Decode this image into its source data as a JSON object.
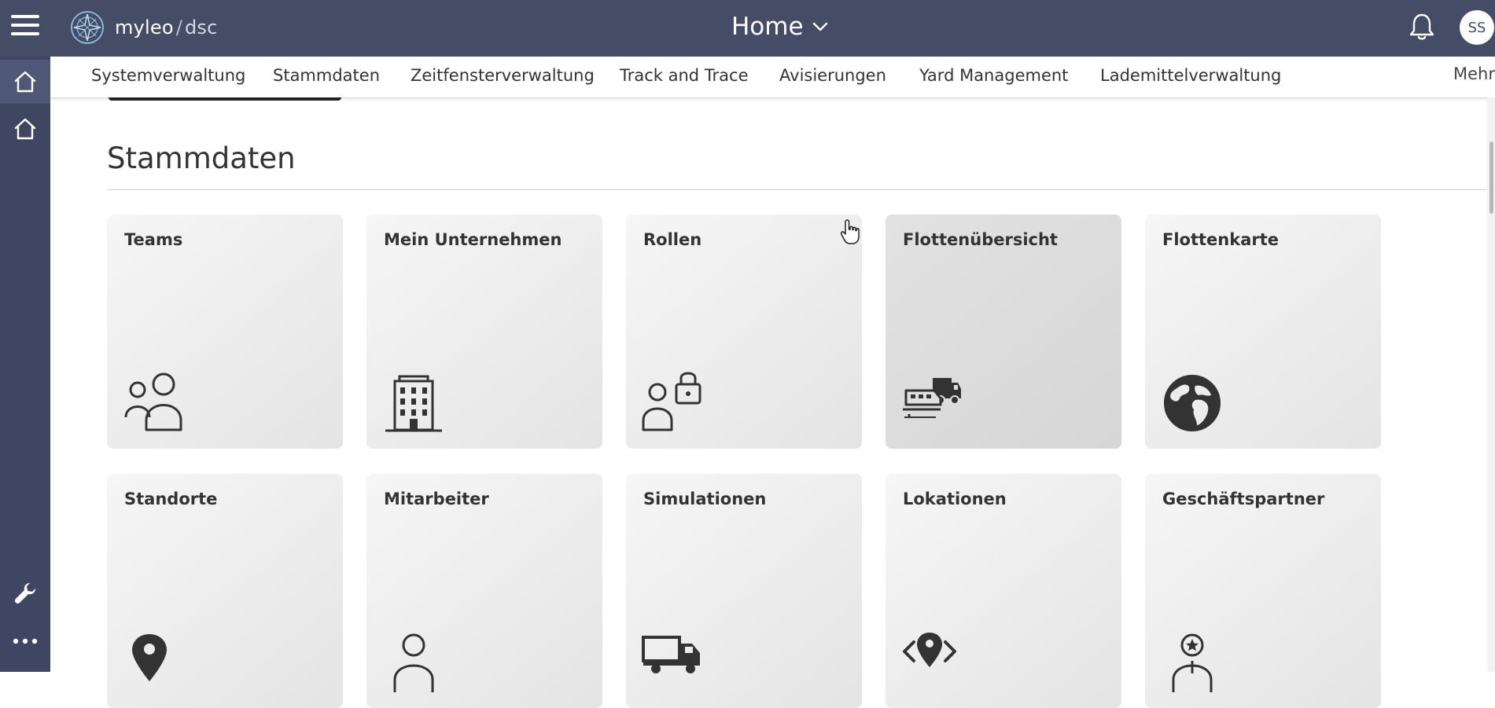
{
  "header": {
    "brand": "myleo",
    "brand_separator": "/",
    "brand_sub": "dsc",
    "title": "Home",
    "avatar_initials": "SS"
  },
  "nav": {
    "tabs": [
      {
        "label": "Systemverwaltung"
      },
      {
        "label": "Stammdaten"
      },
      {
        "label": "Zeitfensterverwaltung"
      },
      {
        "label": "Track and Trace"
      },
      {
        "label": "Avisierungen"
      },
      {
        "label": "Yard Management"
      },
      {
        "label": "Lademittelverwaltung"
      }
    ],
    "more_label": "Mehr"
  },
  "section": {
    "title": "Stammdaten",
    "tiles": [
      {
        "label": "Teams",
        "icon": "teams-icon"
      },
      {
        "label": "Mein Unternehmen",
        "icon": "building-icon"
      },
      {
        "label": "Rollen",
        "icon": "user-lock-icon"
      },
      {
        "label": "Flottenübersicht",
        "icon": "fleet-overview-icon"
      },
      {
        "label": "Flottenkarte",
        "icon": "globe-icon"
      },
      {
        "label": "Standorte",
        "icon": "map-pin-icon"
      },
      {
        "label": "Mitarbeiter",
        "icon": "person-icon"
      },
      {
        "label": "Simulationen",
        "icon": "truck-icon"
      },
      {
        "label": "Lokationen",
        "icon": "location-code-icon"
      },
      {
        "label": "Geschäftspartner",
        "icon": "partner-star-icon"
      }
    ]
  },
  "colors": {
    "header_bg": "#454c66",
    "rail_bg": "#3f4662",
    "tile_bg": "#ececec",
    "tile_hover_bg": "#dcdcdc"
  }
}
